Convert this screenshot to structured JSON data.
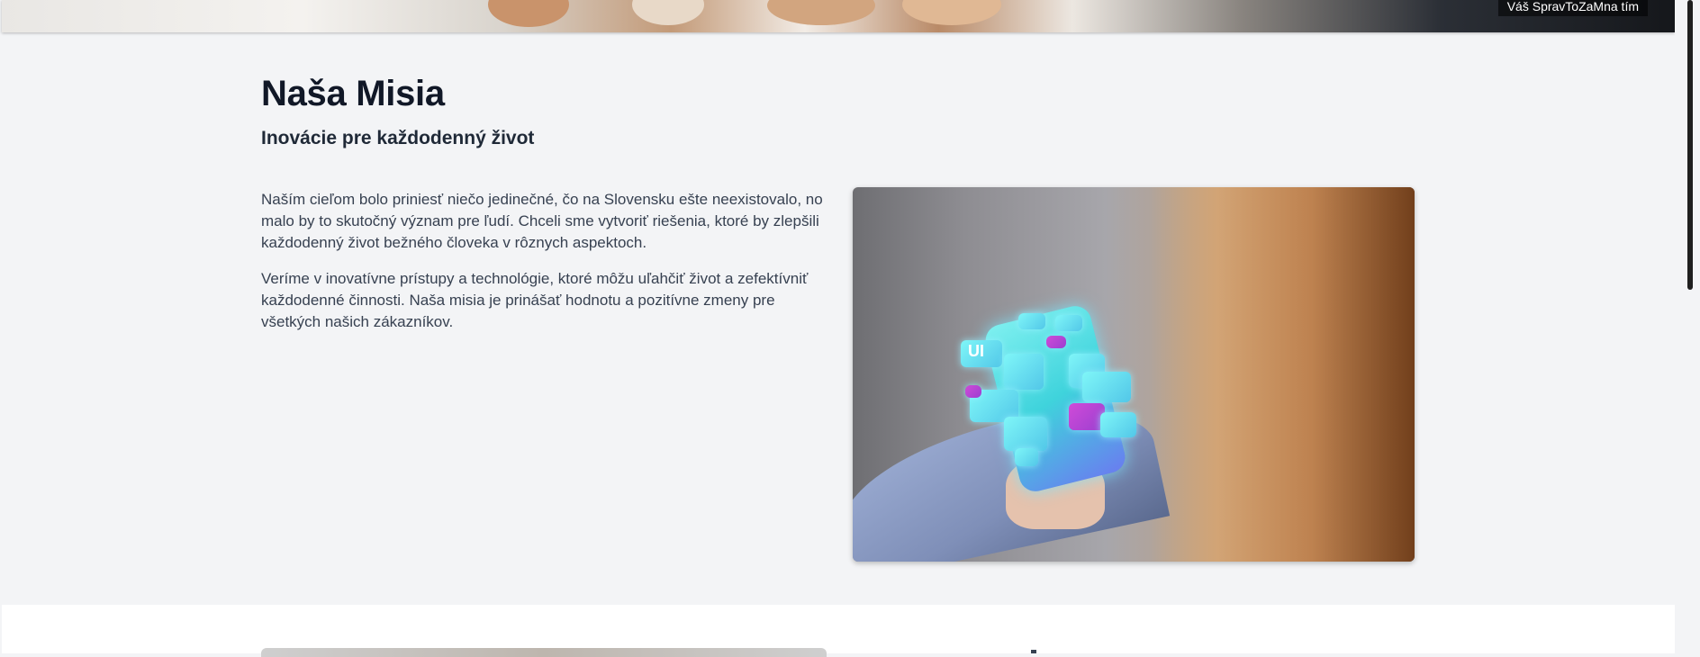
{
  "hero": {
    "caption": "Váš SpravToZaMna tím"
  },
  "mission": {
    "title": "Naša Misia",
    "subtitle": "Inovácie pre každodenný život",
    "paragraphs": [
      "Naším cieľom bolo priniesť niečo jedinečné, čo na Slovensku ešte neexistovalo, no malo by to skutočný význam pre ľudí. Chceli sme vytvoriť riešenia, ktoré by zlepšili každodenný život bežného človeka v rôznych aspektoch.",
      "Veríme v inovatívne prístupy a technológie, ktoré môžu uľahčiť život a zefektívniť každodenné činnosti. Naša misia je prinášať hodnotu a pozitívne zmeny pre všetkých našich zákazníkov."
    ],
    "image": {
      "ui_label": "UI"
    }
  }
}
